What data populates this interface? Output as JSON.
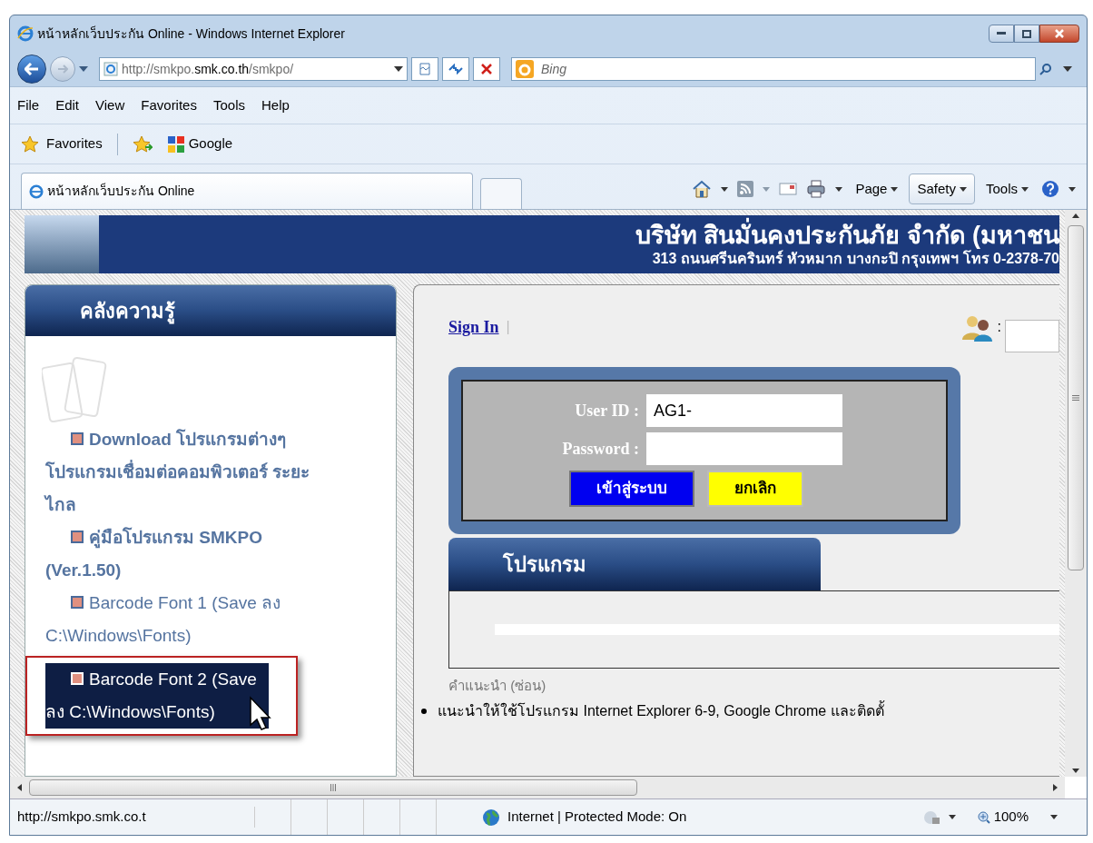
{
  "window": {
    "title": "หน้าหลักเว็บประกัน Online - Windows Internet Explorer"
  },
  "address_bar": {
    "url": "http://smkpo.**smk.co.th**/smkpo/"
  },
  "search": {
    "placeholder": "Bing"
  },
  "menu": [
    "File",
    "Edit",
    "View",
    "Favorites",
    "Tools",
    "Help"
  ],
  "favorites_bar": {
    "label": "Favorites",
    "links": [
      "Google"
    ]
  },
  "tab": {
    "title": "หน้าหลักเว็บประกัน Online"
  },
  "command_bar": [
    {
      "label": "Page",
      "highlighted": false
    },
    {
      "label": "Safety",
      "highlighted": true
    },
    {
      "label": "Tools",
      "highlighted": false
    }
  ],
  "page": {
    "header": {
      "company": "บริษัท สินมั่นคงประกันภัย จำกัด (มหาชน",
      "address": "313 ถนนศรีนครินทร์ หัวหมาก บางกะปิ กรุงเทพฯ โทร 0-2378-70"
    },
    "sidebar": {
      "title": "คลังความรู้",
      "links": [
        {
          "text": "Download โปรแกรมต่างๆ โปรแกรมเชื่อมต่อคอมพิวเตอร์ ระยะไกล",
          "bold": true,
          "selected": false
        },
        {
          "text": "คู่มือโปรแกรม SMKPO (Ver.1.50)",
          "bold": true,
          "selected": false
        },
        {
          "text": "Barcode Font 1 (Save ลง C:\\Windows\\Fonts)",
          "bold": false,
          "selected": false
        },
        {
          "text": "Barcode Font 2 (Save ลง C:\\Windows\\Fonts)",
          "bold": false,
          "selected": true
        }
      ]
    },
    "sign_in": "Sign In",
    "separator": "|",
    "user_colon": ":",
    "login": {
      "user_label": "User ID :",
      "user_value": "AG1-",
      "password_label": "Password :",
      "submit": "เข้าสู่ระบบ",
      "cancel": "ยกเลิก"
    },
    "program_panel": {
      "title": "โปรแกรม"
    },
    "tips": {
      "heading": "คำแนะนำ (ซ่อน)",
      "items": [
        "แนะนำให้ใช้โปรแกรม Internet Explorer 6-9, Google Chrome และติดตั้"
      ]
    }
  },
  "status_bar": {
    "url": "http://smkpo.smk.co.t",
    "zone": "Internet | Protected Mode: On",
    "zoom": "100%"
  }
}
